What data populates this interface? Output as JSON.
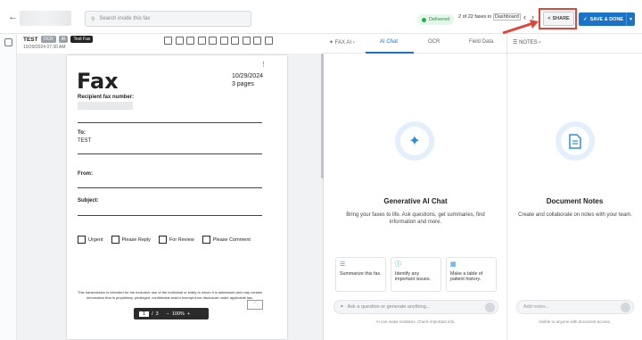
{
  "header": {
    "search_placeholder": "Search inside this fax",
    "status": "Delivered",
    "counter_prefix": "2 of 22 faxes in",
    "counter_folder": "Dashboard",
    "share_label": "SHARE",
    "save_label": "SAVE & DONE"
  },
  "document": {
    "title": "TEST",
    "tags": [
      "OCR",
      "AI",
      "Test Fax"
    ],
    "date": "10/29/2024 07:30 AM",
    "page": {
      "heading": "Fax",
      "date": "10/29/2024",
      "pages": "3 pages",
      "recipient_label": "Recipient fax number:",
      "to_label": "To:",
      "to_value": "TEST",
      "from_label": "From:",
      "subject_label": "Subject:",
      "checkboxes": [
        "Urgent",
        "Please Reply",
        "For Review",
        "Please Comment"
      ],
      "disclaimer": "This transmission is intended for the exclusive use of the individual or entity to whom it is addressed and may contain information that is proprietary, privileged, confidential and/or exempt from disclosure under applicable law."
    },
    "pager": {
      "current": "1",
      "total": "3",
      "zoom": "100%"
    }
  },
  "ai_panel": {
    "breadcrumb": "FAX AI",
    "tabs": [
      "AI Chat",
      "OCR",
      "Field Data"
    ],
    "title": "Generative AI Chat",
    "description": "Bring your faxes to life. Ask questions, get summaries, find information and more.",
    "cards": [
      "Summarize this fax.",
      "Identify any important issues.",
      "Make a table of patient history."
    ],
    "ask_placeholder": "Ask a question or generate anything...",
    "footer": "AI can make mistakes. Check important info."
  },
  "notes_panel": {
    "header": "NOTES",
    "title": "Document Notes",
    "description": "Create and collaborate on notes with your team.",
    "add_placeholder": "Add notes...",
    "footer": "Visible to anyone with document access."
  }
}
